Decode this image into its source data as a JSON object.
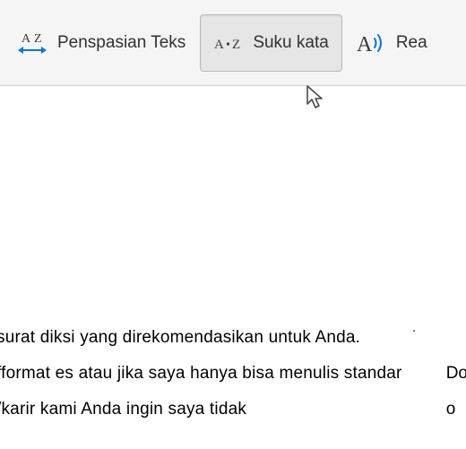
{
  "toolbar": {
    "text_spacing_label": "Penspasian Teks",
    "syllables_label": "Suku kata",
    "read_aloud_label": "Rea"
  },
  "content": {
    "line1": " surat diksi yang direkomendasikan untuk Anda.",
    "line2": "fformat es atau jika saya hanya bisa menulis standar",
    "line3": "/karir kami Anda ingin saya tidak",
    "right1": "Do",
    "right2": "",
    "right3": "o"
  }
}
